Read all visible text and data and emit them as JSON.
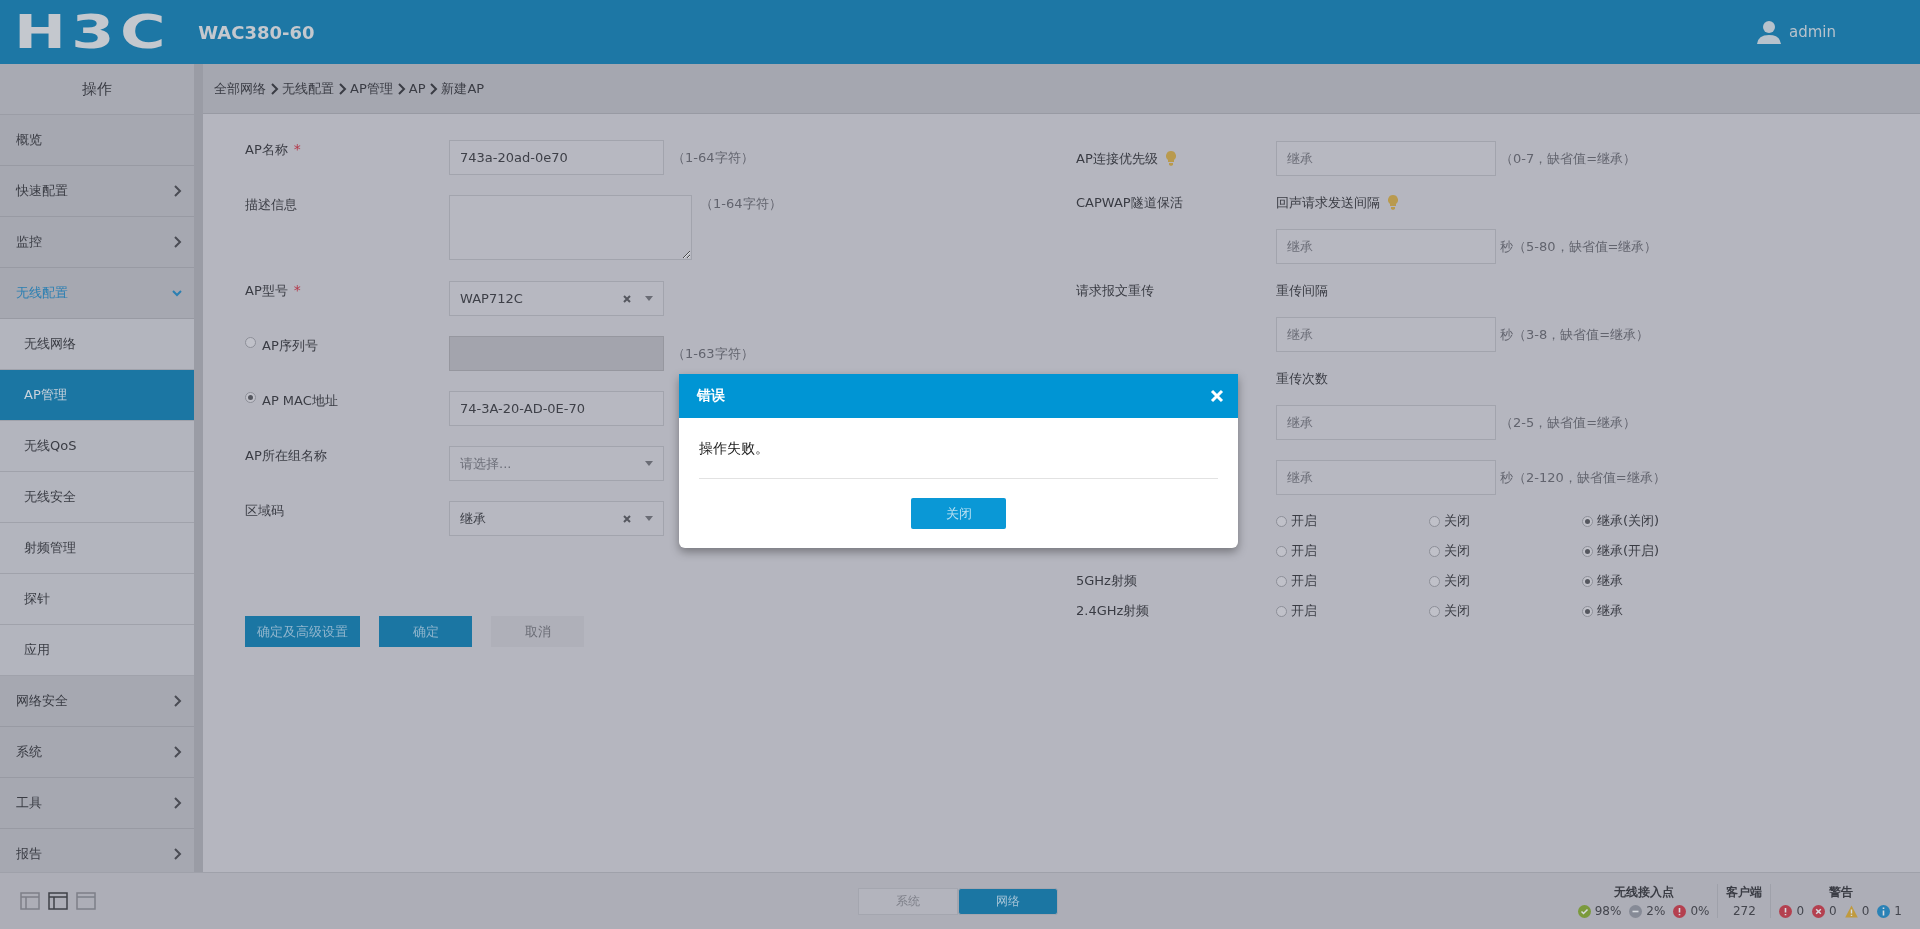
{
  "header": {
    "logo": "H3C",
    "model": "WAC380-60",
    "user": "admin"
  },
  "sidebar": {
    "title": "操作",
    "items": [
      {
        "label": "概览",
        "kind": "leaf"
      },
      {
        "label": "快速配置",
        "kind": "group",
        "expanded": false
      },
      {
        "label": "监控",
        "kind": "group",
        "expanded": false
      },
      {
        "label": "无线配置",
        "kind": "group",
        "expanded": true,
        "children": [
          {
            "label": "无线网络",
            "selected": false
          },
          {
            "label": "AP管理",
            "selected": true
          },
          {
            "label": "无线QoS",
            "selected": false
          },
          {
            "label": "无线安全",
            "selected": false
          },
          {
            "label": "射频管理",
            "selected": false
          },
          {
            "label": "探针",
            "selected": false
          },
          {
            "label": "应用",
            "selected": false
          }
        ]
      },
      {
        "label": "网络安全",
        "kind": "group",
        "expanded": false
      },
      {
        "label": "系统",
        "kind": "group",
        "expanded": false
      },
      {
        "label": "工具",
        "kind": "group",
        "expanded": false
      },
      {
        "label": "报告",
        "kind": "group",
        "expanded": false
      }
    ]
  },
  "breadcrumb": [
    "全部网络",
    "无线配置",
    "AP管理",
    "AP",
    "新建AP"
  ],
  "left": {
    "fields": [
      {
        "kind": "text",
        "label": "AP名称",
        "required_mark": "*",
        "value": "743a-20ad-0e70",
        "hint": "（1-64字符）"
      },
      {
        "kind": "textarea",
        "label": "描述信息",
        "hint": "（1-64字符）"
      },
      {
        "kind": "select",
        "label": "AP型号",
        "required_mark": "*",
        "value": "WAP712C",
        "clearable": true
      },
      {
        "kind": "radio-text",
        "label": "AP序列号",
        "selected": false,
        "disabled": true,
        "hint": "（1-63字符）"
      },
      {
        "kind": "radio-text",
        "label": "AP MAC地址",
        "selected": true,
        "value": "74-3A-20-AD-0E-70"
      },
      {
        "kind": "select",
        "label": "AP所在组名称",
        "placeholder": "请选择..."
      },
      {
        "kind": "select",
        "label": "区域码",
        "value": "继承",
        "clearable": true
      }
    ],
    "buttons": [
      {
        "label": "确定及高级设置",
        "disabled": false
      },
      {
        "label": "确定",
        "disabled": false
      },
      {
        "label": "取消",
        "disabled": true
      }
    ]
  },
  "right": {
    "rows": [
      {
        "kind": "input",
        "label": "AP连接优先级",
        "tip": true,
        "placeholder": "继承",
        "hint": "（0-7，缺省值=继承）"
      },
      {
        "kind": "heading",
        "label": "CAPWAP隧道保活",
        "sublabel": "回声请求发送间隔",
        "tip": true
      },
      {
        "kind": "input",
        "placeholder": "继承",
        "hint": "秒（5-80，缺省值=继承）"
      },
      {
        "kind": "heading",
        "label": "请求报文重传",
        "sublabel": "重传间隔"
      },
      {
        "kind": "input",
        "placeholder": "继承",
        "hint": "秒（3-8，缺省值=继承）"
      },
      {
        "kind": "heading",
        "sublabel": "重传次数"
      },
      {
        "kind": "input",
        "placeholder": "继承",
        "hint": "（2-5，缺省值=继承）"
      },
      {
        "kind": "input",
        "placeholder": "继承",
        "hint": "秒（2-120，缺省值=继承）"
      },
      {
        "kind": "radios",
        "options": [
          {
            "label": "开启",
            "selected": false
          },
          {
            "label": "关闭",
            "selected": false
          },
          {
            "label": "继承(关闭)",
            "selected": true
          }
        ]
      },
      {
        "kind": "radios",
        "options": [
          {
            "label": "开启",
            "selected": false
          },
          {
            "label": "关闭",
            "selected": false
          },
          {
            "label": "继承(开启)",
            "selected": true
          }
        ]
      },
      {
        "kind": "radios",
        "label": "5GHz射频",
        "options": [
          {
            "label": "开启",
            "selected": false
          },
          {
            "label": "关闭",
            "selected": false
          },
          {
            "label": "继承",
            "selected": true
          }
        ]
      },
      {
        "kind": "radios",
        "label": "2.4GHz射频",
        "options": [
          {
            "label": "开启",
            "selected": false
          },
          {
            "label": "关闭",
            "selected": false
          },
          {
            "label": "继承",
            "selected": true
          }
        ]
      }
    ]
  },
  "dialog": {
    "title": "错误",
    "message": "操作失败。",
    "button": "关闭"
  },
  "footer": {
    "views": [
      {
        "selected": false
      },
      {
        "selected": true
      },
      {
        "selected": false
      }
    ],
    "tabs": [
      {
        "label": "系统",
        "selected": false
      },
      {
        "label": "网络",
        "selected": true
      }
    ],
    "status": [
      {
        "title": "无线接入点",
        "items": [
          {
            "kind": "ok",
            "color": "#7b9a3c",
            "value": "98%"
          },
          {
            "kind": "minus",
            "color": "#868a96",
            "value": "2%"
          },
          {
            "kind": "alert",
            "color": "#b4404f",
            "value": "0%"
          }
        ]
      },
      {
        "title": "客户端",
        "items": [
          {
            "kind": "plain",
            "value": "272"
          }
        ]
      },
      {
        "title": "警告",
        "items": [
          {
            "kind": "alert",
            "color": "#b4404f",
            "value": "0"
          },
          {
            "kind": "error",
            "color": "#b4404f",
            "value": "0"
          },
          {
            "kind": "warning",
            "color": "#c09a3e",
            "value": "0"
          },
          {
            "kind": "info",
            "color": "#2a82b6",
            "value": "1"
          }
        ]
      }
    ]
  }
}
